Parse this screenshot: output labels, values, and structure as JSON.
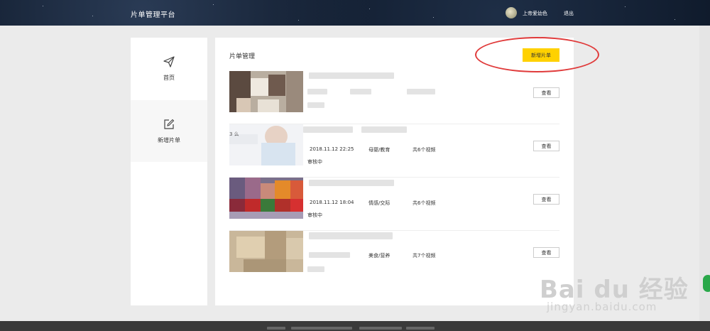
{
  "header": {
    "brand": "片单管理平台",
    "username": "上帝爱幼色",
    "logout": "退出"
  },
  "sidebar": {
    "items": [
      {
        "label": "首页",
        "icon": "paper-plane-icon"
      },
      {
        "label": "新增片单",
        "icon": "edit-icon"
      }
    ]
  },
  "main": {
    "title": "片单管理",
    "add_button": "新增片单",
    "view_label": "查看",
    "rows": [
      {
        "date": "",
        "category": "",
        "count": "",
        "status": ""
      },
      {
        "date": "2018.11.12 22:25",
        "category": "母婴/教育",
        "count": "共6个视频",
        "status": "审核中",
        "title_fragment": "3 么"
      },
      {
        "date": "2018.11.12 18:04",
        "category": "情感/交际",
        "count": "共6个视频",
        "status": "审核中"
      },
      {
        "date": "",
        "category": "美食/营养",
        "count": "共7个视频",
        "status": ""
      }
    ]
  },
  "colors": {
    "accent": "#ffd100",
    "annotation": "#e03a3a",
    "topbar": "#0f1a2b"
  },
  "watermark": {
    "logo": "Bai du 经验",
    "url": "jingyan.baidu.com"
  }
}
